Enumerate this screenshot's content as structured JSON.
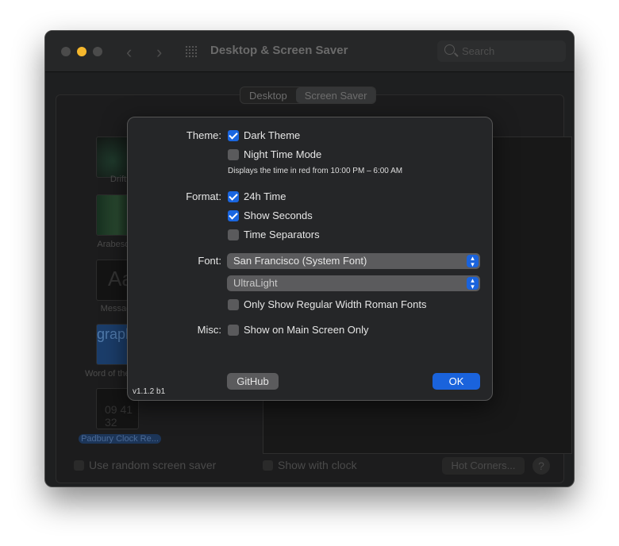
{
  "window": {
    "title": "Desktop & Screen Saver",
    "search_placeholder": "Search"
  },
  "tabs": [
    {
      "label": "Desktop",
      "selected": false
    },
    {
      "label": "Screen Saver",
      "selected": true
    }
  ],
  "savers": [
    {
      "label": "Drift"
    },
    {
      "label": "Arabesque"
    },
    {
      "label": "Message",
      "thumb_text": "Aa"
    },
    {
      "label": "Word of the Day",
      "thumb_text": "graphy"
    },
    {
      "label": "Padbury Clock Re...",
      "thumb_text": "09 41 32",
      "selected": true
    }
  ],
  "bottom": {
    "random_label": "Use random screen saver",
    "clock_label": "Show with clock",
    "hot_corners": "Hot Corners...",
    "help": "?"
  },
  "sheet": {
    "theme_label": "Theme:",
    "dark_theme": {
      "label": "Dark Theme",
      "checked": true
    },
    "night_mode": {
      "label": "Night Time Mode",
      "checked": false
    },
    "night_note": "Displays the time in red from 10:00 PM – 6:00 AM",
    "format_label": "Format:",
    "h24": {
      "label": "24h Time",
      "checked": true
    },
    "seconds": {
      "label": "Show Seconds",
      "checked": true
    },
    "separators": {
      "label": "Time Separators",
      "checked": false
    },
    "font_label": "Font:",
    "font_value": "San Francisco (System Font)",
    "weight_value": "UltraLight",
    "roman_only": {
      "label": "Only Show Regular Width Roman Fonts",
      "checked": false
    },
    "misc_label": "Misc:",
    "main_only": {
      "label": "Show on Main Screen Only",
      "checked": false
    },
    "github": "GitHub",
    "ok": "OK",
    "version": "v1.1.2 b1"
  },
  "colors": {
    "accent": "#1a66e0",
    "close": "#4b4b4b",
    "minimize": "#f5b72d"
  }
}
